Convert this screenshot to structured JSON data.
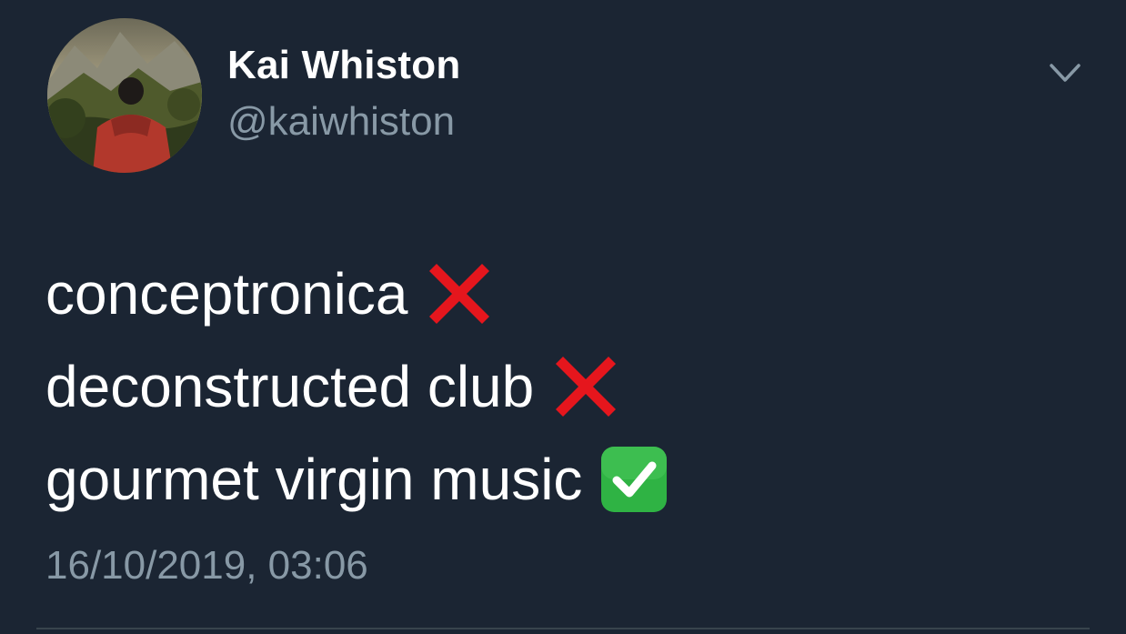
{
  "user": {
    "display_name": "Kai Whiston",
    "handle": "@kaiwhiston",
    "avatar_icon": "profile-photo-person-red-jacket-landscape"
  },
  "tweet": {
    "lines": [
      {
        "text": "conceptronica",
        "emoji": "cross-mark-icon"
      },
      {
        "text": "deconstructed club",
        "emoji": "cross-mark-icon"
      },
      {
        "text": "gourmet virgin music",
        "emoji": "check-mark-button-icon"
      }
    ],
    "timestamp": "16/10/2019, 03:06"
  },
  "menu": {
    "icon": "chevron-down-icon"
  },
  "colors": {
    "background": "#1b2533",
    "text_primary": "#ffffff",
    "text_secondary": "#8899a6",
    "cross": "#e5161d",
    "check": "#2fb344"
  }
}
